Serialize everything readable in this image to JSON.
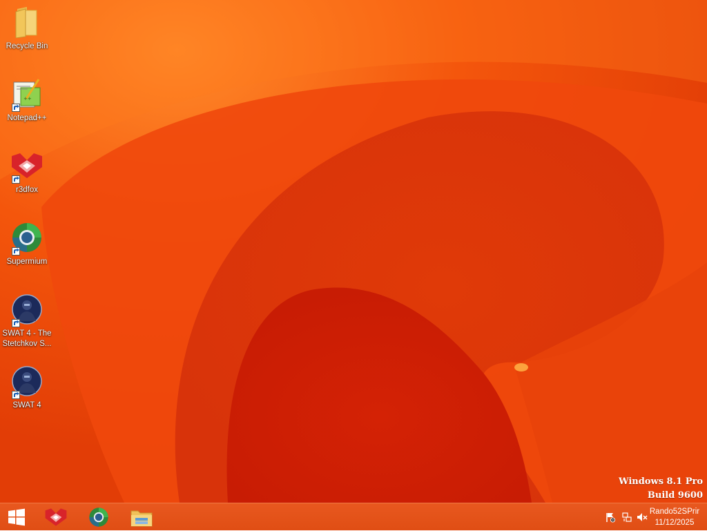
{
  "desktop": {
    "icons": [
      {
        "label": "Recycle Bin",
        "icon": "folder-icon"
      },
      {
        "label": "Notepad++",
        "icon": "notepadpp-icon"
      },
      {
        "label": "r3dfox",
        "icon": "r3dfox-icon"
      },
      {
        "label": "Supermium",
        "icon": "supermium-icon"
      },
      {
        "label_line1": "SWAT 4 - The",
        "label_line2": "Stetchkov S...",
        "icon": "swat4-icon"
      },
      {
        "label": "SWAT 4",
        "icon": "swat4-icon"
      }
    ],
    "watermark": {
      "line1": "Windows 8.1 Pro",
      "line2": "Build 9600"
    },
    "wallpaper_colors": {
      "base": "#ee4a08",
      "dark": "#d42a05",
      "light": "#ff7b1a"
    }
  },
  "taskbar": {
    "start_icon": "windows-logo-icon",
    "pinned": [
      {
        "name": "r3dfox",
        "icon": "r3dfox-icon"
      },
      {
        "name": "Supermium",
        "icon": "supermium-icon"
      },
      {
        "name": "File Explorer",
        "icon": "file-explorer-icon"
      }
    ],
    "tray": {
      "icons": [
        "action-center-flag-icon",
        "network-icon",
        "volume-muted-icon"
      ],
      "user": "Rando52SPrir",
      "date": "11/12/2025"
    }
  }
}
